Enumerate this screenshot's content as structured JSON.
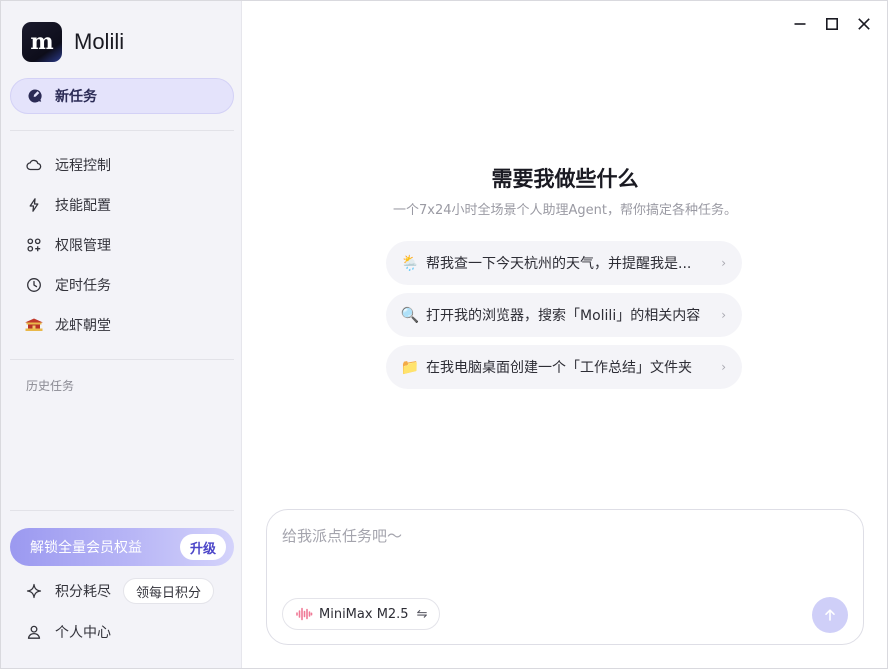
{
  "app": {
    "name": "Molili",
    "logo_text": "m"
  },
  "sidebar": {
    "new_task": "新任务",
    "items": [
      {
        "label": "远程控制",
        "icon": "cloud-icon"
      },
      {
        "label": "技能配置",
        "icon": "lightning-icon"
      },
      {
        "label": "权限管理",
        "icon": "grid-icon"
      },
      {
        "label": "定时任务",
        "icon": "clock-icon"
      },
      {
        "label": "龙虾朝堂",
        "icon": "temple-icon"
      }
    ],
    "history_label": "历史任务",
    "upgrade": {
      "text": "解锁全量会员权益",
      "button": "升级"
    },
    "points": {
      "label": "积分耗尽",
      "button": "领每日积分"
    },
    "profile": "个人中心"
  },
  "main": {
    "heading": "需要我做些什么",
    "subheading": "一个7x24小时全场景个人助理Agent，帮你搞定各种任务。",
    "suggestions": [
      {
        "emoji": "🌦️",
        "text": "帮我查一下今天杭州的天气，并提醒我是..."
      },
      {
        "emoji": "🔍",
        "text": "打开我的浏览器，搜索「Molili」的相关内容"
      },
      {
        "emoji": "📁",
        "text": "在我电脑桌面创建一个「工作总结」文件夹"
      }
    ],
    "composer": {
      "placeholder": "给我派点任务吧〜",
      "model": "MiniMax M2.5",
      "switch_symbol": "⇋"
    }
  },
  "colors": {
    "accent": "#5b55d6",
    "sidebar_bg": "#f3f3f8",
    "new_task_bg": "#e4e3fb",
    "send_button": "#cfcff8"
  }
}
